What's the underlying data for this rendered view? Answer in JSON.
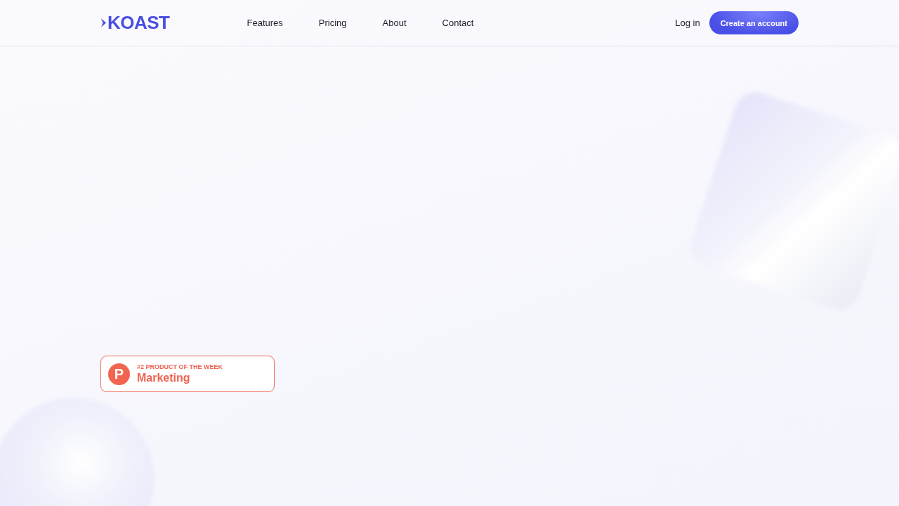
{
  "header": {
    "logo": "KOAST",
    "nav": [
      "Features",
      "Pricing",
      "About",
      "Contact"
    ],
    "login": "Log in",
    "signup": "Create an account"
  },
  "badge": {
    "icon_letter": "P",
    "rank": "#2 PRODUCT OF THE WEEK",
    "category": "Marketing"
  }
}
